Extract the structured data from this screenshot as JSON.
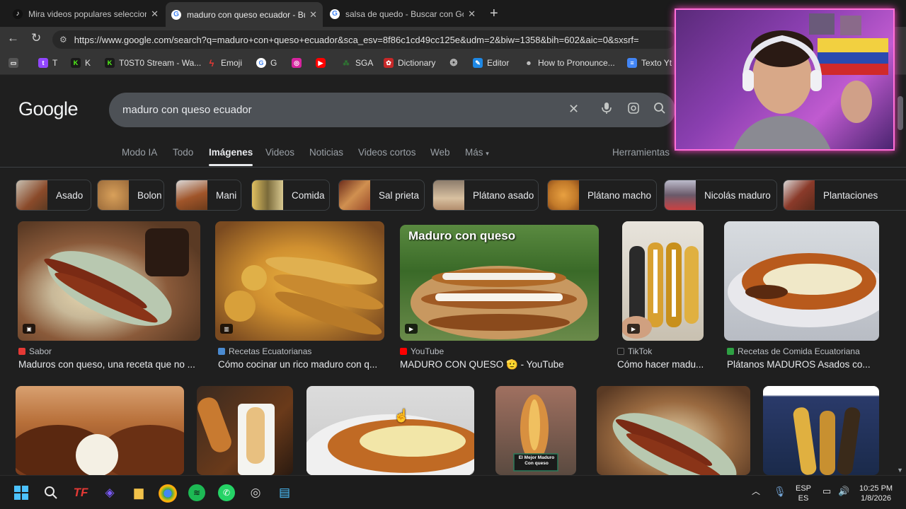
{
  "tabs": [
    {
      "label": "Mira videos populares seleccionad",
      "icon": "tiktok-icon",
      "active": false
    },
    {
      "label": "maduro con queso ecuador - Busc",
      "icon": "google-icon",
      "active": true
    },
    {
      "label": "salsa de quedo - Buscar con Goog",
      "icon": "google-icon",
      "active": false
    }
  ],
  "address": {
    "url": "https://www.google.com/search?q=maduro+con+queso+ecuador&sca_esv=8f86c1cd49cc125e&udm=2&biw=1358&bih=602&aic=0&sxsrf="
  },
  "bookmarks": [
    {
      "label": "T",
      "icon": "twitch-icon",
      "color": "#9146ff"
    },
    {
      "label": "K",
      "icon": "kick-icon",
      "color": "#53fc18"
    },
    {
      "label": "T0ST0 Stream - Wa...",
      "icon": "kick-icon",
      "color": "#53fc18"
    },
    {
      "label": "Emoji",
      "icon": "bolt-icon",
      "color": "#e53935"
    },
    {
      "label": "G",
      "icon": "google-icon",
      "color": "#4285f4"
    },
    {
      "label": "",
      "icon": "instagram-icon",
      "color": "#d6249f"
    },
    {
      "label": "",
      "icon": "youtube-icon",
      "color": "#ff0000"
    },
    {
      "label": "SGA",
      "icon": "sga-icon",
      "color": "#2e7d32"
    },
    {
      "label": "Dictionary",
      "icon": "dictionary-icon",
      "color": "#c62828"
    },
    {
      "label": "",
      "icon": "openai-icon",
      "color": "#888888"
    },
    {
      "label": "Editor",
      "icon": "editor-icon",
      "color": "#1e88e5"
    },
    {
      "label": "How to Pronounce...",
      "icon": "person-icon",
      "color": "#aaaaaa"
    },
    {
      "label": "Texto Yt",
      "icon": "docs-icon",
      "color": "#4285f4"
    }
  ],
  "google": {
    "logo": "Google",
    "query": "maduro con queso ecuador",
    "nav": [
      "Modo IA",
      "Todo",
      "Imágenes",
      "Videos",
      "Noticias",
      "Videos cortos",
      "Web",
      "Más"
    ],
    "active_nav": "Imágenes",
    "tools": "Herramientas"
  },
  "chips": [
    {
      "label": "Asado",
      "color": "#8a4a2a"
    },
    {
      "label": "Bolon",
      "color": "#c28a4a"
    },
    {
      "label": "Mani",
      "color": "#a0552a"
    },
    {
      "label": "Comida",
      "color": "#7a6a3a"
    },
    {
      "label": "Sal prieta",
      "color": "#9a4a2a"
    },
    {
      "label": "Plátano asado",
      "color": "#b08a6a"
    },
    {
      "label": "Plátano macho",
      "color": "#c27a2a"
    },
    {
      "label": "Nicolás maduro",
      "color": "#6a5a6a"
    },
    {
      "label": "Plantaciones",
      "color": "#8a3a2a"
    }
  ],
  "results_row1": [
    {
      "source": "Sabor",
      "source_color": "#e53935",
      "caption": "Maduros con queso, una receta que no ...",
      "badge": "image",
      "overlay": ""
    },
    {
      "source": "Recetas Ecuatorianas",
      "source_color": "#4a8ad0",
      "caption": "Cómo cocinar un rico maduro con q...",
      "badge": "shorts",
      "overlay": ""
    },
    {
      "source": "YouTube",
      "source_color": "#ff0000",
      "caption": "MADURO CON QUESO 🫡 - YouTube",
      "badge": "play",
      "overlay": "Maduro con queso"
    },
    {
      "source": "TikTok",
      "source_color": "#ffffff",
      "caption": "Cómo hacer madu...",
      "badge": "play",
      "overlay": ""
    },
    {
      "source": "Recetas de Comida Ecuatoriana",
      "source_color": "#2ea043",
      "caption": "Plátanos MADUROS Asados co...",
      "badge": "",
      "overlay": ""
    }
  ],
  "results_row2_overlay": "El Mejor Maduro Con queso",
  "taskbar": {
    "language": "ESP",
    "language2": "ES",
    "time": "10:25 PM",
    "date": "1/8/2026"
  }
}
